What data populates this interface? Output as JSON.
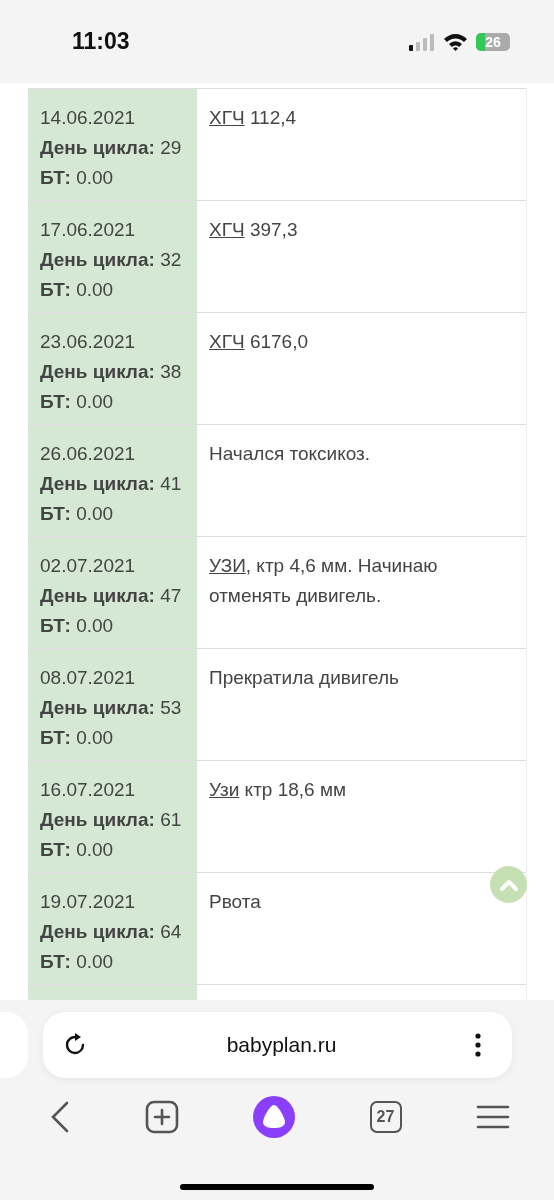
{
  "status_bar": {
    "time": "11:03",
    "battery": "26"
  },
  "entries": [
    {
      "date": "14.06.2021",
      "cycle_label": "День цикла:",
      "cycle_day": "29",
      "bt_label": "БТ:",
      "bt": "0.00",
      "note": [
        {
          "text": "ХГЧ",
          "link": true
        },
        {
          "text": " 112,4",
          "link": false
        }
      ]
    },
    {
      "date": "17.06.2021",
      "cycle_label": "День цикла:",
      "cycle_day": "32",
      "bt_label": "БТ:",
      "bt": "0.00",
      "note": [
        {
          "text": "ХГЧ",
          "link": true
        },
        {
          "text": " 397,3",
          "link": false
        }
      ]
    },
    {
      "date": "23.06.2021",
      "cycle_label": "День цикла:",
      "cycle_day": "38",
      "bt_label": "БТ:",
      "bt": "0.00",
      "note": [
        {
          "text": "ХГЧ",
          "link": true
        },
        {
          "text": " 6176,0",
          "link": false
        }
      ]
    },
    {
      "date": "26.06.2021",
      "cycle_label": "День цикла:",
      "cycle_day": "41",
      "bt_label": "БТ:",
      "bt": "0.00",
      "note": [
        {
          "text": "Начался токсикоз.",
          "link": false
        }
      ]
    },
    {
      "date": "02.07.2021",
      "cycle_label": "День цикла:",
      "cycle_day": "47",
      "bt_label": "БТ:",
      "bt": "0.00",
      "note": [
        {
          "text": "УЗИ",
          "link": true
        },
        {
          "text": ", ктр 4,6 мм. Начинаю отменять дивигель.",
          "link": false
        }
      ]
    },
    {
      "date": "08.07.2021",
      "cycle_label": "День цикла:",
      "cycle_day": "53",
      "bt_label": "БТ:",
      "bt": "0.00",
      "note": [
        {
          "text": "Прекратила дивигель",
          "link": false
        }
      ]
    },
    {
      "date": "16.07.2021",
      "cycle_label": "День цикла:",
      "cycle_day": "61",
      "bt_label": "БТ:",
      "bt": "0.00",
      "note": [
        {
          "text": "Узи",
          "link": true
        },
        {
          "text": " ктр 18,6 мм",
          "link": false
        }
      ]
    },
    {
      "date": "19.07.2021",
      "cycle_label": "День цикла:",
      "cycle_day": "64",
      "bt_label": "БТ:",
      "bt": "0.00",
      "note": [
        {
          "text": "Рвота",
          "link": false
        }
      ]
    }
  ],
  "browser": {
    "url": "babyplan.ru",
    "tabs_count": "27"
  }
}
